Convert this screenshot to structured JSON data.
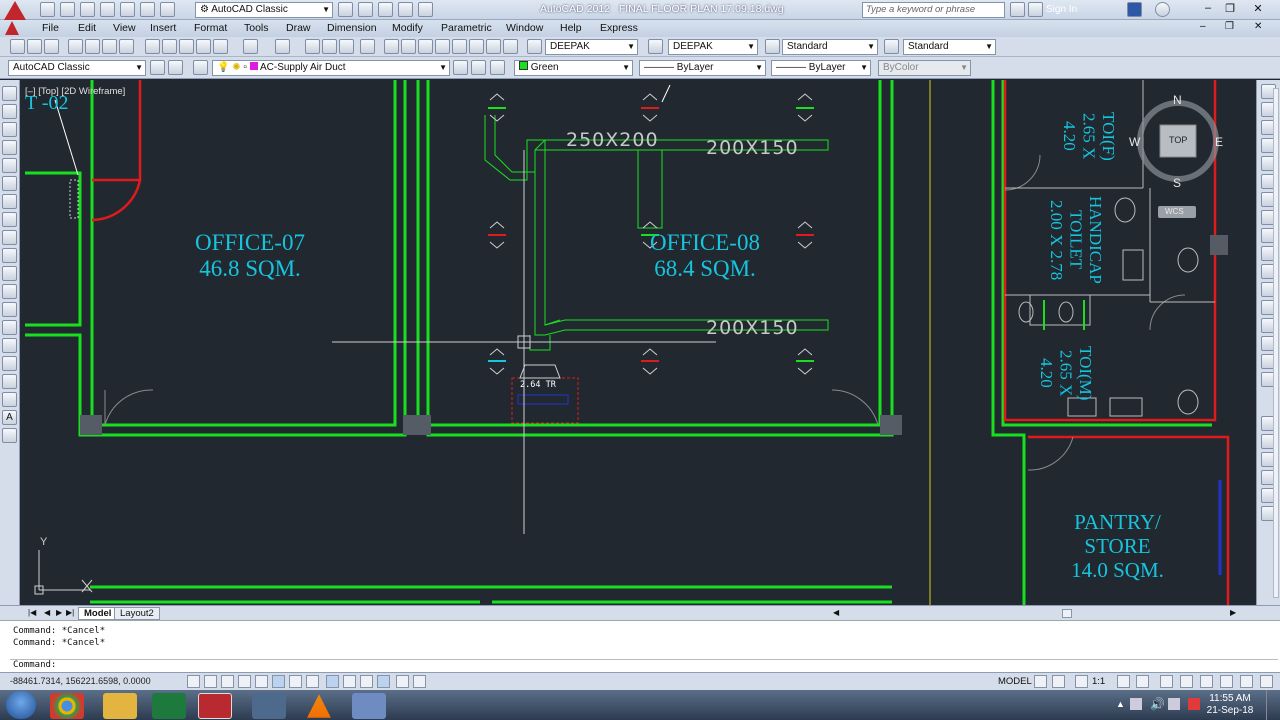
{
  "window": {
    "app_title": "AutoCAD 2012",
    "file_title": "FINAL FLOOR PLAN 17.09.18.dwg",
    "workspace": "AutoCAD Classic",
    "search_placeholder": "Type a keyword or phrase",
    "sign_in": "Sign In"
  },
  "menu": [
    "File",
    "Edit",
    "View",
    "Insert",
    "Format",
    "Tools",
    "Draw",
    "Dimension",
    "Modify",
    "Parametric",
    "Window",
    "Help",
    "Express"
  ],
  "toolbar1": {
    "text_style": "DEEPAK",
    "dim_style": "DEEPAK",
    "table_style": "Standard",
    "mleader_style": "Standard"
  },
  "toolbar2": {
    "workspace": "AutoCAD Classic",
    "layer": "AC-Supply Air Duct",
    "color": "Green",
    "linetype": "ByLayer",
    "lineweight": "ByLayer",
    "plotstyle": "ByColor"
  },
  "viewport": {
    "label": "[–] [Top] [2D Wireframe]",
    "room_tag_left": "T -02"
  },
  "rooms": {
    "office07_name": "OFFICE-07",
    "office07_area": "46.8 SQM.",
    "office08_name": "OFFICE-08",
    "office08_area": "68.4 SQM.",
    "toi_f": "TOI(F)",
    "toi_f_size": "2.65 X 4.20",
    "handicap_1": "HANDICAP",
    "handicap_2": "TOILET",
    "handicap_size": "2.00 X 2.78",
    "toi_m": "TOI(M)",
    "toi_m_size_1": "2.65 X",
    "toi_m_size_2": "4.20",
    "pantry_1": "PANTRY/",
    "pantry_2": "STORE",
    "pantry_area": "14.0 SQM."
  },
  "ducts": {
    "main": "250X200",
    "branch_top": "200X150",
    "branch_bottom": "200X150",
    "unit": "2.64 TR"
  },
  "viewcube": {
    "top": "TOP",
    "n": "N",
    "s": "S",
    "e": "E",
    "w": "W",
    "wcs": "WCS"
  },
  "ucs": {
    "y": "Y"
  },
  "tabs": [
    "Model",
    "Layout2"
  ],
  "command": {
    "history": [
      "Command: *Cancel*",
      "Command: *Cancel*"
    ],
    "prompt": "Command:"
  },
  "status": {
    "coords": "-88461.7314, 156221.6598, 0.0000",
    "model": "MODEL",
    "scale": "1:1"
  },
  "taskbar": {
    "time": "11:55 AM",
    "date": "21-Sep-18"
  },
  "colors": {
    "wall_green": "#19e01e",
    "wall_red": "#e01b1b",
    "room_text": "#17c4de",
    "background": "#212830"
  }
}
